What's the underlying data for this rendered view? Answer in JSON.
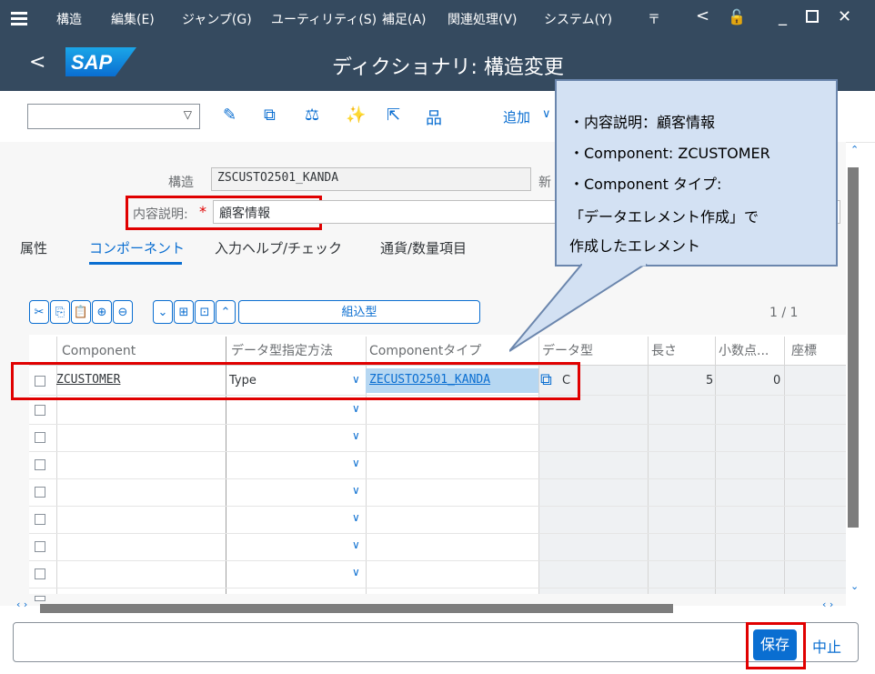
{
  "menu": {
    "items": [
      "構造",
      "編集(E)",
      "ジャンプ(G)",
      "ユーティリティ(S)",
      "補足(A)",
      "関連処理(V)",
      "システム(Y)"
    ],
    "more": "〒"
  },
  "title": "ディクショナリ: 構造変更",
  "logo": "SAP",
  "toolbar": {
    "add_label": "追加"
  },
  "form": {
    "structure_label": "構造",
    "structure_value": "ZSCUSTO2501_KANDA",
    "new_label": "新",
    "desc_label": "内容説明:",
    "desc_required": "*",
    "desc_value": "顧客情報"
  },
  "tabs": [
    "属性",
    "コンポーネント",
    "入力ヘルプ/チェック",
    "通貨/数量項目"
  ],
  "table_toolbar": {
    "builtin_type_label": "組込型",
    "page_indicator": "1 / 1"
  },
  "table": {
    "columns": [
      "Component",
      "データ型指定方法",
      "Componentタイプ",
      "データ型",
      "長さ",
      "小数点...",
      "座標"
    ],
    "rows": [
      {
        "component": "ZCUSTOMER",
        "method": "Type",
        "comp_type": "ZECUSTO2501_KANDA",
        "data_type": "C",
        "length": "5",
        "decimals": "0"
      }
    ]
  },
  "callout": {
    "lines": [
      "・内容説明：顧客情報",
      "・Component: ZCUSTOMER",
      "・Component タイプ:",
      "「データエレメント作成」で",
      "作成したエレメント"
    ]
  },
  "footer": {
    "save_label": "保存",
    "cancel_label": "中止"
  },
  "colors": {
    "shell": "#354a5f",
    "accent": "#0a6ed1",
    "highlight": "#e00000",
    "callout_bg": "#d3e1f3"
  }
}
